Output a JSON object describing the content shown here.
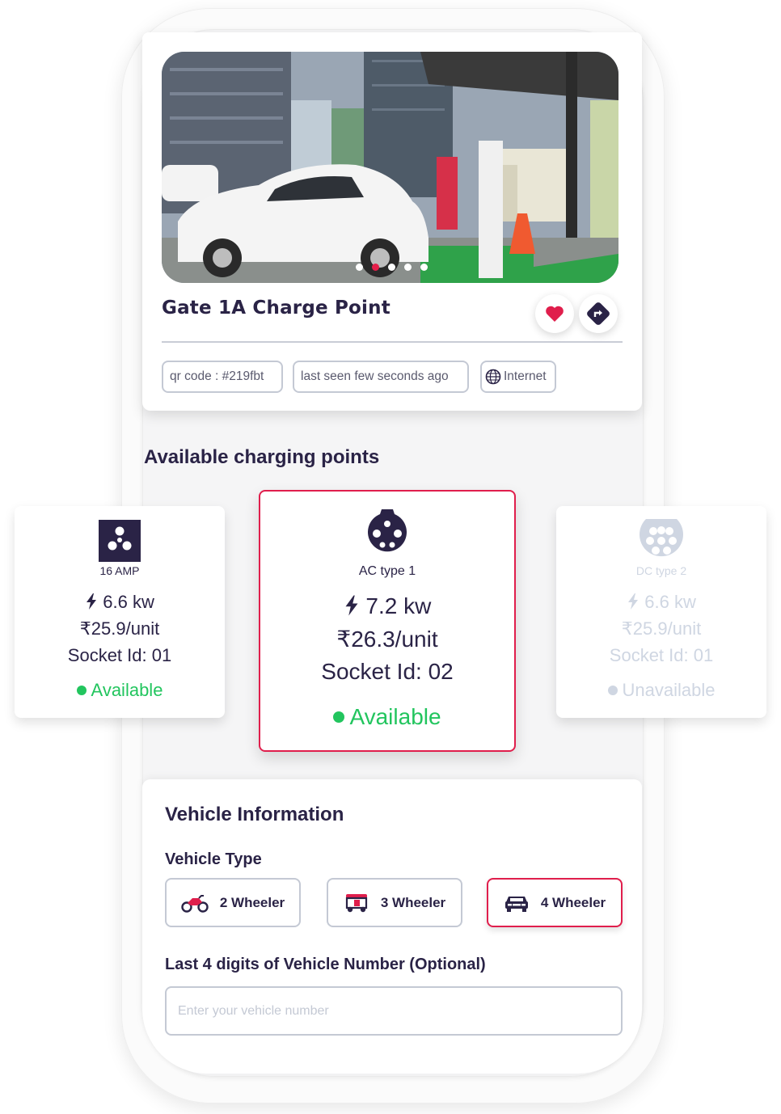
{
  "station": {
    "name": "Gate 1A Charge Point",
    "carousel": {
      "total": 5,
      "active": 1
    },
    "chips": {
      "qr_code": "qr code : #219fbt",
      "last_seen": "last seen few seconds ago",
      "connectivity": "Internet"
    }
  },
  "charging_section": {
    "heading": "Available charging points"
  },
  "charging_points": [
    {
      "type": "16 AMP",
      "power": "6.6 kw",
      "price": "₹25.9/unit",
      "socket": "Socket Id: 01",
      "status": "Available",
      "icon": "16-amp-plug-icon"
    },
    {
      "type": "AC type 1",
      "power": "7.2 kw",
      "price": "₹26.3/unit",
      "socket": "Socket Id: 02",
      "status": "Available",
      "icon": "ac-type1-plug-icon",
      "selected": true
    },
    {
      "type": "DC type 2",
      "power": "6.6 kw",
      "price": "₹25.9/unit",
      "socket": "Socket Id: 01",
      "status": "Unavailable",
      "icon": "dc-type2-plug-icon"
    }
  ],
  "vehicle": {
    "title": "Vehicle Information",
    "type_label": "Vehicle Type",
    "types": [
      {
        "label": "2 Wheeler",
        "icon": "motorcycle-icon"
      },
      {
        "label": "3 Wheeler",
        "icon": "auto-rickshaw-icon"
      },
      {
        "label": "4 Wheeler",
        "icon": "car-icon",
        "selected": true
      }
    ],
    "number_label": "Last 4 digits of Vehicle Number (Optional)",
    "number_placeholder": "Enter your vehicle number"
  },
  "colors": {
    "accent": "#e01e4c",
    "primary": "#2a2346",
    "available": "#22c55e",
    "muted": "#cfd6e2"
  }
}
